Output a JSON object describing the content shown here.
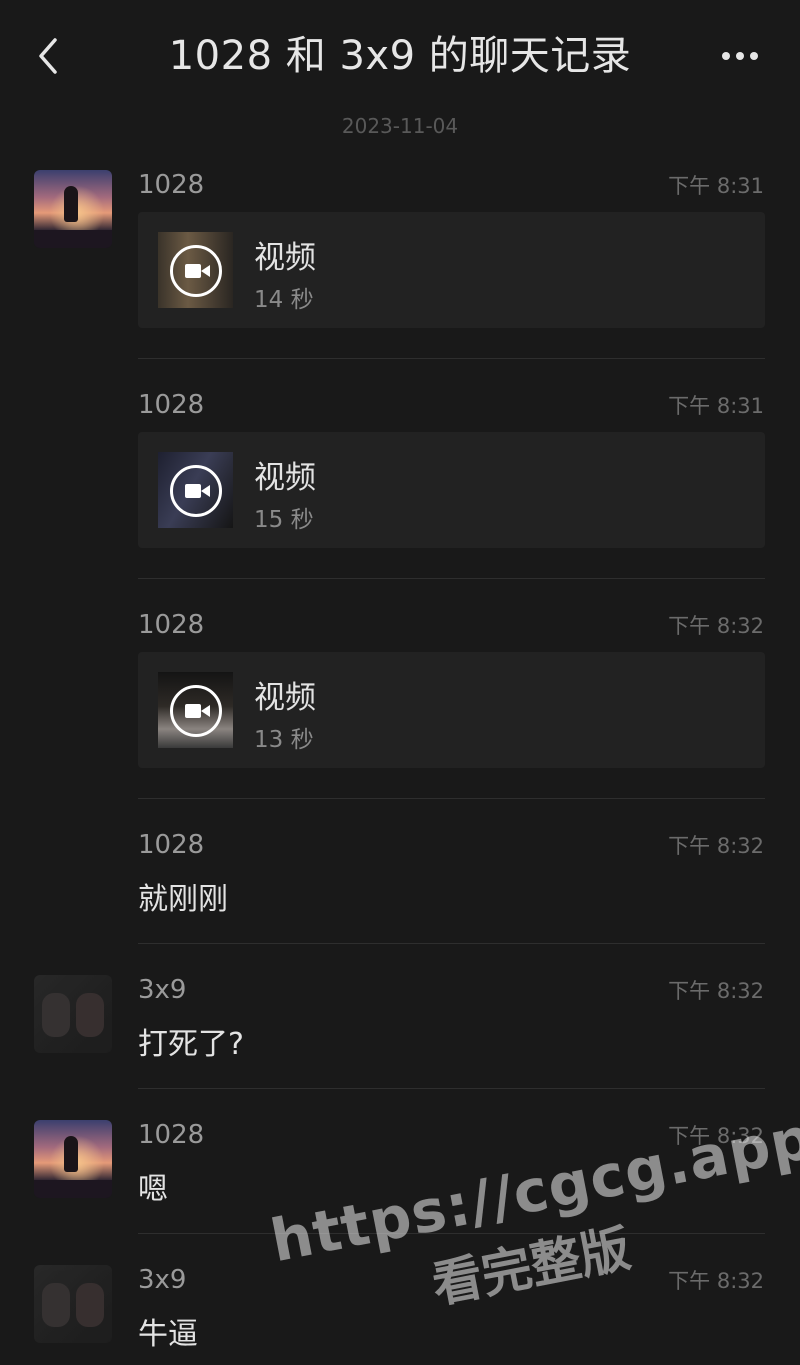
{
  "header": {
    "title": "1028 和 3x9 的聊天记录"
  },
  "date_separator": "2023-11-04",
  "messages": [
    {
      "sender": "1028",
      "time": "下午 8:31",
      "type": "video",
      "video_label": "视频",
      "duration": "14 秒",
      "avatar": "sunset"
    },
    {
      "sender": "1028",
      "time": "下午 8:31",
      "type": "video",
      "video_label": "视频",
      "duration": "15 秒"
    },
    {
      "sender": "1028",
      "time": "下午 8:32",
      "type": "video",
      "video_label": "视频",
      "duration": "13 秒"
    },
    {
      "sender": "1028",
      "time": "下午 8:32",
      "type": "text",
      "text": "就刚刚"
    },
    {
      "sender": "3x9",
      "time": "下午 8:32",
      "type": "text",
      "text": "打死了?",
      "avatar": "bears"
    },
    {
      "sender": "1028",
      "time": "下午 8:32",
      "type": "text",
      "text": "嗯",
      "avatar": "sunset"
    },
    {
      "sender": "3x9",
      "time": "下午 8:32",
      "type": "text",
      "text": "牛逼",
      "avatar": "bears"
    }
  ],
  "watermark": {
    "url": "https://cgcg.app",
    "subtitle": "看完整版"
  }
}
